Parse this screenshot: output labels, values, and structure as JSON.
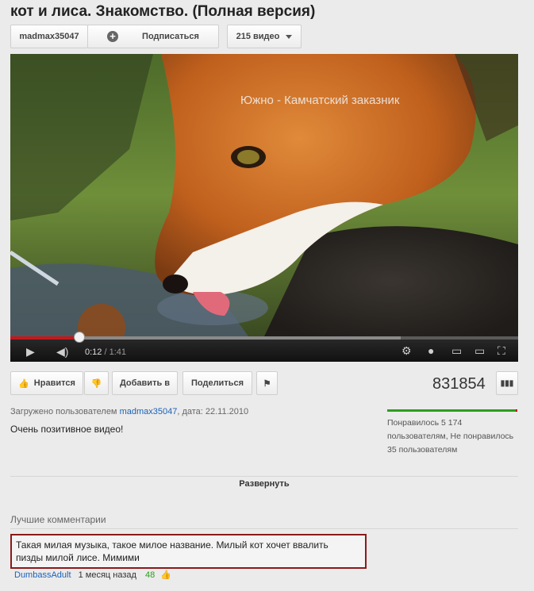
{
  "title": "кот и лиса. Знакомство. (Полная версия)",
  "channel": {
    "name": "madmax35047",
    "subscribe_label": "Подписаться",
    "videos_label": "215 видео"
  },
  "video": {
    "watermark": "Южно - Камчатский заказник",
    "time_current": "0:12",
    "time_total": "/ 1:41",
    "progress": 0.134
  },
  "actions": {
    "like_label": "Нравится",
    "add_label": "Добавить в",
    "share_label": "Поделиться"
  },
  "views": "831854",
  "uploaded": {
    "prefix": "Загружено пользователем",
    "user": "madmax35047",
    "date_text": ", дата: 22.11.2010"
  },
  "description": "Очень позитивное видео!",
  "likes_text": "Понравилось 5 174 пользователям, Не понравилось 35 пользователям",
  "expand_label": "Развернуть",
  "comments": {
    "header": "Лучшие комментарии",
    "items": [
      {
        "text": "Такая милая музыка, такое милое название. Милый кот хочет ввалить пизды милой лисе. Мимими",
        "author": "DumbassAdult",
        "date": "1 месяц назад",
        "rating": "48"
      }
    ]
  },
  "colors": {
    "progress_played": "#c4181b",
    "like_bar": "#2c9e1d",
    "highlight_border": "#8b1a1a",
    "link": "#1c62b9"
  }
}
